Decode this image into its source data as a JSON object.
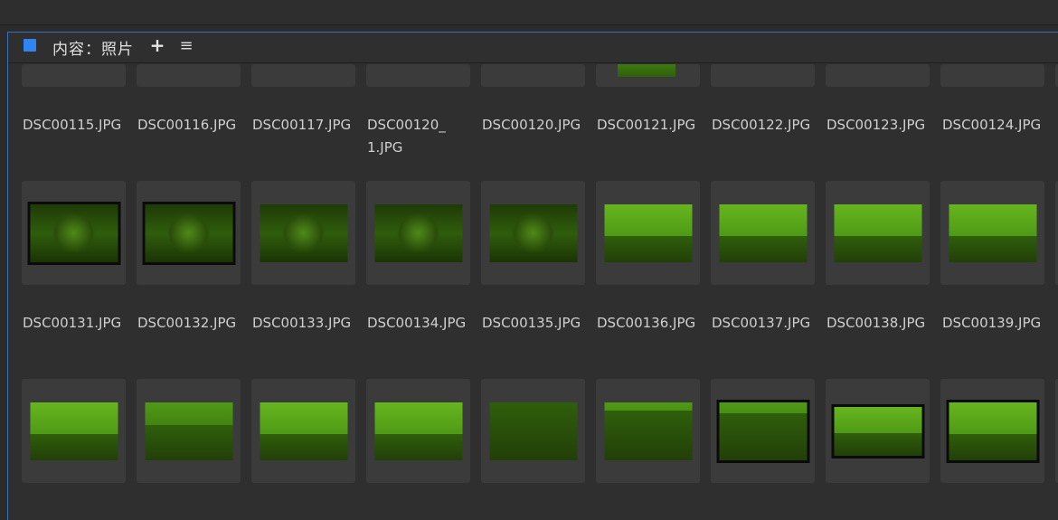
{
  "panel": {
    "title": "内容：照片",
    "add_icon": "+",
    "menu_icon": "≡"
  },
  "rows": [
    {
      "labels": [
        "DSC00115.JPG",
        "DSC00116.JPG",
        "DSC00117.JPG",
        "DSC00120_1.JPG",
        "DSC00120.JPG",
        "DSC00121.JPG",
        "DSC00122.JPG",
        "DSC00123.JPG",
        "DSC00124.JPG"
      ]
    },
    {
      "labels": [
        "DSC00131.JPG",
        "DSC00132.JPG",
        "DSC00133.JPG",
        "DSC00134.JPG",
        "DSC00135.JPG",
        "DSC00136.JPG",
        "DSC00137.JPG",
        "DSC00138.JPG",
        "DSC00139.JPG"
      ]
    }
  ],
  "colors": {
    "accent": "#2f86f2",
    "thumb_tint": "#4f9a16",
    "card_bg": "#3b3b3b",
    "panel_bg": "#2f2f2f"
  }
}
